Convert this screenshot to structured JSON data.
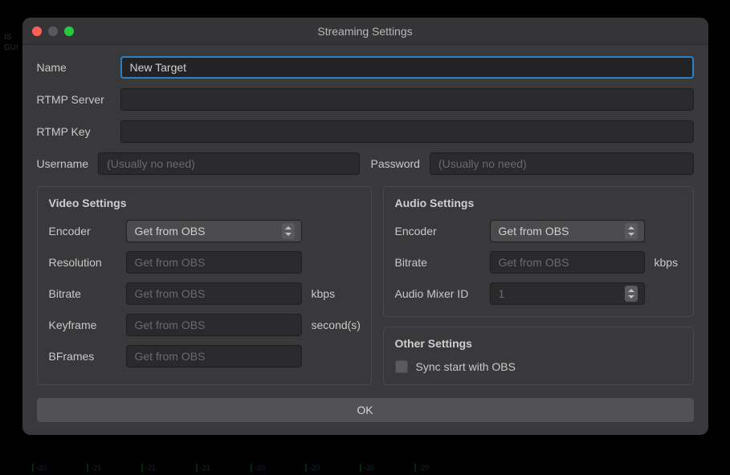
{
  "window_title": "Streaming Settings",
  "labels": {
    "name": "Name",
    "rtmp_server": "RTMP Server",
    "rtmp_key": "RTMP Key",
    "username": "Username",
    "password": "Password"
  },
  "values": {
    "name": "New Target",
    "rtmp_server": "",
    "rtmp_key": "",
    "username": "",
    "password": ""
  },
  "placeholders": {
    "username": "(Usually no need)",
    "password": "(Usually no need)"
  },
  "video": {
    "section_title": "Video Settings",
    "encoder_label": "Encoder",
    "encoder_value": "Get from OBS",
    "resolution_label": "Resolution",
    "resolution_placeholder": "Get from OBS",
    "bitrate_label": "Bitrate",
    "bitrate_placeholder": "Get from OBS",
    "bitrate_unit": "kbps",
    "keyframe_label": "Keyframe",
    "keyframe_placeholder": "Get from OBS",
    "keyframe_unit": "second(s)",
    "bframes_label": "BFrames",
    "bframes_placeholder": "Get from OBS"
  },
  "audio": {
    "section_title": "Audio Settings",
    "encoder_label": "Encoder",
    "encoder_value": "Get from OBS",
    "bitrate_label": "Bitrate",
    "bitrate_placeholder": "Get from OBS",
    "bitrate_unit": "kbps",
    "mixer_label": "Audio Mixer ID",
    "mixer_value": "1"
  },
  "other": {
    "section_title": "Other Settings",
    "sync_label": "Sync start with OBS",
    "sync_checked": false
  },
  "ok_label": "OK",
  "bg": {
    "meter_values": [
      "-20",
      "-21",
      "-21",
      "-21",
      "-20",
      "-20",
      "-20",
      "-20"
    ]
  }
}
